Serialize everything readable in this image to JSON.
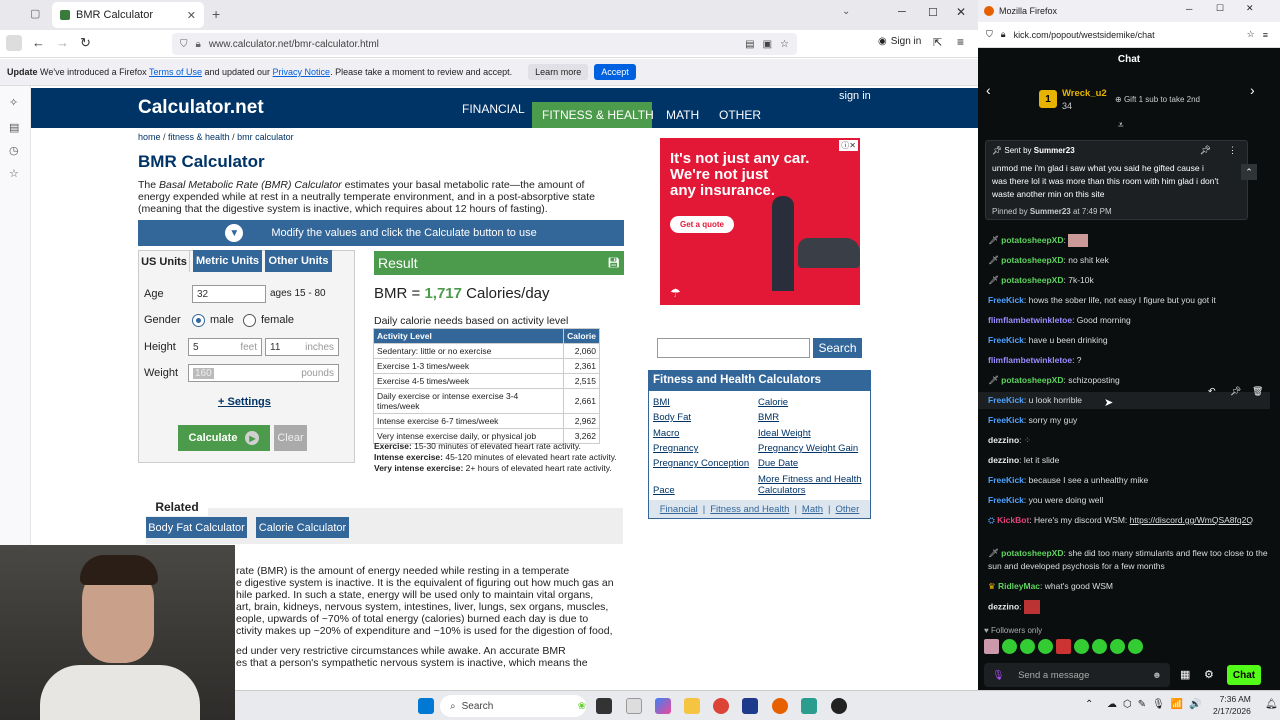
{
  "left_browser": {
    "tab_title": "BMR Calculator",
    "url": "www.calculator.net/bmr-calculator.html",
    "sign_in": "Sign in",
    "notice": {
      "bold": "Update",
      "text1": " We've introduced a Firefox ",
      "link1": "Terms of Use",
      "text2": " and updated our ",
      "link2": "Privacy Notice",
      "text3": ". Please take a moment to review and accept.",
      "learn": "Learn more",
      "accept": "Accept"
    }
  },
  "site": {
    "logo": "Calculator.net",
    "signin": "sign in",
    "nav": [
      "FINANCIAL",
      "FITNESS & HEALTH",
      "MATH",
      "OTHER"
    ],
    "breadcrumb": [
      "home",
      "fitness & health",
      "bmr calculator"
    ],
    "title": "BMR Calculator",
    "intro_pre": "The ",
    "intro_em": "Basal Metabolic Rate (BMR) Calculator",
    "intro_post": " estimates your basal metabolic rate—the amount of energy expended while at rest in a neutrally temperate environment, and in a post-absorptive state (meaning that the digestive system is inactive, which requires about 12 hours of fasting).",
    "modify": "Modify the values and click the Calculate button to use",
    "unit_tabs": [
      "US Units",
      "Metric Units",
      "Other Units"
    ],
    "form": {
      "age_label": "Age",
      "age": "32",
      "age_hint": "ages 15 - 80",
      "gender_label": "Gender",
      "male": "male",
      "female": "female",
      "height_label": "Height",
      "feet": "5",
      "feet_unit": "feet",
      "inches": "11",
      "inches_unit": "inches",
      "weight_label": "Weight",
      "weight": "160",
      "weight_unit": "pounds",
      "settings": "+ Settings",
      "calculate": "Calculate",
      "clear": "Clear"
    },
    "result": {
      "header": "Result",
      "prefix": "BMR = ",
      "value": "1,717",
      "suffix": " Calories/day",
      "daily": "Daily calorie needs based on activity level",
      "th": [
        "Activity Level",
        "Calorie"
      ],
      "rows": [
        [
          "Sedentary: little or no exercise",
          "2,060"
        ],
        [
          "Exercise 1-3 times/week",
          "2,361"
        ],
        [
          "Exercise 4-5 times/week",
          "2,515"
        ],
        [
          "Daily exercise or intense exercise 3-4 times/week",
          "2,661"
        ],
        [
          "Intense exercise 6-7 times/week",
          "2,962"
        ],
        [
          "Very intense exercise daily, or physical job",
          "3,262"
        ]
      ],
      "notes": [
        [
          "Exercise:",
          " 15-30 minutes of elevated heart rate activity."
        ],
        [
          "Intense exercise:",
          " 45-120 minutes of elevated heart rate activity."
        ],
        [
          "Very intense exercise:",
          " 2+ hours of elevated heart rate activity."
        ]
      ]
    },
    "ad": {
      "line1": "It's not just any car.",
      "line2": "We're not just",
      "line3": "any insurance.",
      "cta": "Get a quote"
    },
    "search_btn": "Search",
    "fh_title": "Fitness and Health Calculators",
    "fh_links": [
      "BMI",
      "Calorie",
      "Body Fat",
      "BMR",
      "Macro",
      "Ideal Weight",
      "Pregnancy",
      "Pregnancy Weight Gain",
      "Pregnancy Conception",
      "Due Date",
      "Pace",
      "More Fitness and Health Calculators"
    ],
    "fh_footer": [
      "Financial",
      "Fitness and Health",
      "Math",
      "Other"
    ],
    "related": "Related",
    "related_btns": [
      "Body Fat Calculator",
      "Calorie Calculator"
    ],
    "body_lines": [
      "rate (BMR) is the amount of energy needed while resting in a temperate",
      "e digestive system is inactive. It is the equivalent of figuring out how much gas an",
      "hile parked. In such a state, energy will be used only to maintain vital organs,",
      "art, brain, kidneys, nervous system, intestines, liver, lungs, sex organs, muscles,",
      "eople, upwards of ~70% of total energy (calories) burned each day is due to",
      "ctivity makes up ~20% of expenditure and ~10% is used for the digestion of food,",
      "ed under very restrictive circumstances while awake. An accurate BMR",
      "es that a person's sympathetic nervous system is inactive, which means the"
    ]
  },
  "chat": {
    "window_title": "Mozilla Firefox",
    "url": "kick.com/popout/westsidemike/chat",
    "header": "Chat",
    "gifter": {
      "rank": "1",
      "name": "Wreck_u2",
      "count": "34",
      "gift": "Gift 1 sub to take 2nd"
    },
    "pinned": {
      "sent_by": "Sent by",
      "sender": "Summer23",
      "text": "unmod me i'm glad i saw what you said he gifted cause i was there lol it was more than this room with him glad i don't waste another min on this site",
      "pinned_by": "Pinned by",
      "pinner": "Summer23",
      "at": "at 7:49 PM"
    },
    "messages": [
      {
        "user": "potatosheepXD",
        "color": "#5fd35f",
        "text": ""
      },
      {
        "user": "potatosheepXD",
        "color": "#5fd35f",
        "text": ": no shit kek"
      },
      {
        "user": "potatosheepXD",
        "color": "#5fd35f",
        "text": ": 7k-10k"
      },
      {
        "user": "FreeKick",
        "color": "#4fa3ff",
        "text": ": hows the sober life, not easy I figure but you got it"
      },
      {
        "user": "flimflambetwinkletoe",
        "color": "#9a8cff",
        "text": ": Good morning"
      },
      {
        "user": "FreeKick",
        "color": "#4fa3ff",
        "text": ": have u been drinking"
      },
      {
        "user": "flimflambetwinkletoe",
        "color": "#9a8cff",
        "text": ": ?"
      },
      {
        "user": "potatosheepXD",
        "color": "#5fd35f",
        "text": ": schizoposting"
      },
      {
        "user": "FreeKick",
        "color": "#4fa3ff",
        "text": ": u look horrible"
      },
      {
        "user": "FreeKick",
        "color": "#4fa3ff",
        "text": ": sorry my guy"
      },
      {
        "user": "dezzino",
        "color": "#e8e8e8",
        "text": ":"
      },
      {
        "user": "dezzino",
        "color": "#e8e8e8",
        "text": ": let it slide"
      },
      {
        "user": "FreeKick",
        "color": "#4fa3ff",
        "text": ": because I see a unhealthy mike"
      },
      {
        "user": "FreeKick",
        "color": "#4fa3ff",
        "text": ": you were doing well"
      }
    ],
    "kickbot": {
      "user": "KickBot",
      "text": ": Here's my discord WSM: ",
      "link": "https://discord.gg/WmQSA8fq2Q"
    },
    "long_msg": {
      "user": "potatosheepXD",
      "text": ": she did too many stimulants and flew too close to the sun and developed psychosis for a few months"
    },
    "ridley": {
      "user": "RidleyMac",
      "text": ": what's good WSM"
    },
    "last": {
      "user": "dezzino",
      "text": ":"
    },
    "followers_only": "Followers only",
    "send_placeholder": "Send a message",
    "chat_btn": "Chat"
  },
  "taskbar": {
    "search": "Search",
    "time": "7:36 AM",
    "date": "2/17/2026"
  }
}
